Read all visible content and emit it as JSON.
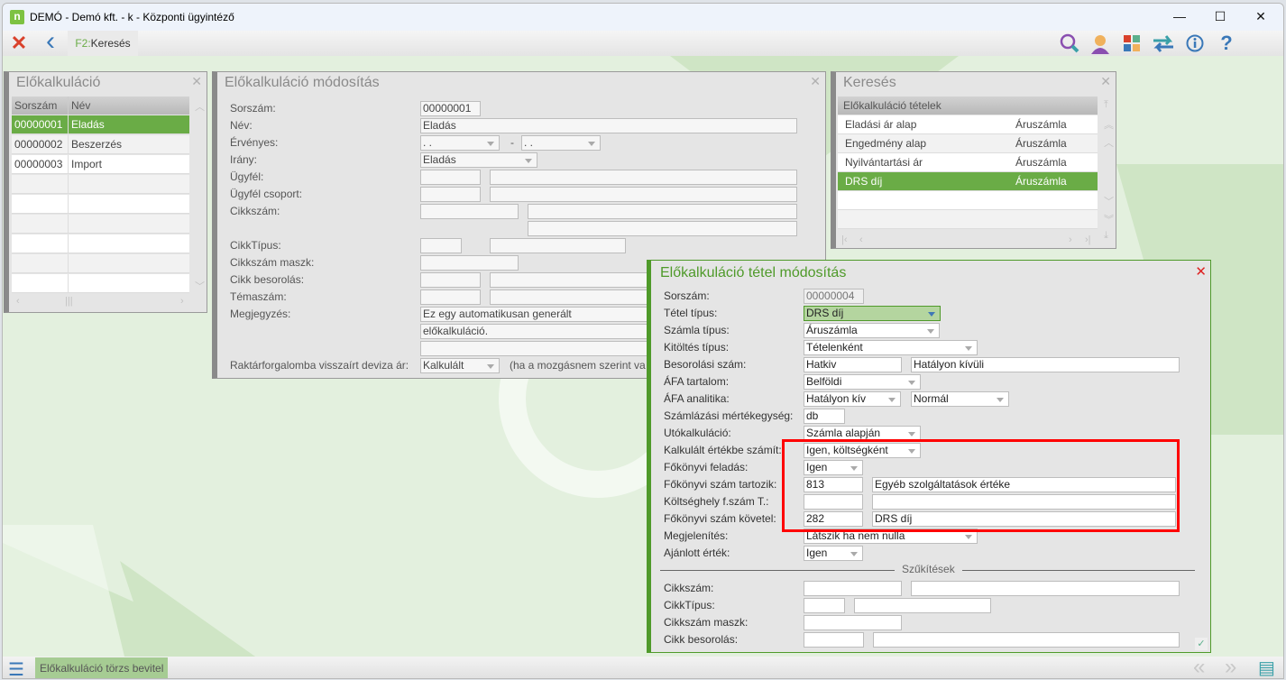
{
  "window": {
    "app_logo": "n",
    "title": "DEMÓ - Demó kft. - k - Központi ügyintéző",
    "minimize": "—",
    "maximize": "☐",
    "close": "✕"
  },
  "toolbar": {
    "close_icon": "✕",
    "back_icon": "‹",
    "search_key": "F2:",
    "search_label": "Keresés",
    "right_icons": [
      "search-icon",
      "user-icon",
      "tiles-icon",
      "transfer-icon",
      "info-icon",
      "help-icon"
    ]
  },
  "list_panel": {
    "title": "Előkalkuláció",
    "close": "✕",
    "columns": [
      "Sorszám",
      "Név"
    ],
    "rows": [
      [
        "00000001",
        "Eladás"
      ],
      [
        "00000002",
        "Beszerzés"
      ],
      [
        "00000003",
        "Import"
      ],
      [
        "",
        ""
      ],
      [
        "",
        ""
      ],
      [
        "",
        ""
      ],
      [
        "",
        ""
      ],
      [
        "",
        ""
      ],
      [
        "",
        ""
      ]
    ],
    "selected": 0
  },
  "edit_panel": {
    "title": "Előkalkuláció módosítás",
    "close": "✕",
    "rows": [
      {
        "label": "Sorszám:",
        "values": [
          "00000001"
        ]
      },
      {
        "label": "Név:",
        "values": [
          "Eladás"
        ]
      },
      {
        "label": "Érvényes:",
        "values": [
          ". .",
          ". ."
        ]
      },
      {
        "label": "Irány:",
        "values": [
          "Eladás"
        ]
      },
      {
        "label": "Ügyfél:",
        "values": [
          "",
          ""
        ]
      },
      {
        "label": "Ügyfél csoport:",
        "values": [
          "",
          ""
        ]
      },
      {
        "label": "Cikkszám:",
        "values": [
          "",
          ""
        ]
      },
      {
        "label": "",
        "values": [
          ""
        ]
      },
      {
        "label": "CikkTípus:",
        "values": [
          "",
          ""
        ]
      },
      {
        "label": "Cikkszám maszk:",
        "values": [
          ""
        ]
      },
      {
        "label": "Cikk besorolás:",
        "values": [
          "",
          ""
        ]
      },
      {
        "label": "Témaszám:",
        "values": [
          "",
          ""
        ]
      },
      {
        "label": "Megjegyzés:",
        "values": [
          "Ez egy automatikusan generált"
        ]
      },
      {
        "label": "",
        "values": [
          "előkalkuláció."
        ]
      },
      {
        "label": "",
        "values": [
          ""
        ]
      },
      {
        "label": "Raktárforgalomba visszaírt deviza ár:",
        "values": [
          "Kalkulált"
        ]
      }
    ],
    "date_separator": "-",
    "note": "(ha a mozgásnem szerint va"
  },
  "search_panel": {
    "title": "Keresés",
    "close": "✕",
    "header": "Előkalkuláció tételek",
    "rows": [
      [
        "Eladási ár alap",
        "Áruszámla"
      ],
      [
        "Engedmény alap",
        "Áruszámla"
      ],
      [
        "Nyilvántartási ár",
        "Áruszámla"
      ],
      [
        "DRS díj",
        "Áruszámla"
      ],
      [
        "",
        ""
      ],
      [
        "",
        ""
      ]
    ],
    "selected": 3
  },
  "dialog": {
    "title": "Előkalkuláció tétel módosítás",
    "close": "✕",
    "rows": [
      {
        "label": "Sorszám:",
        "values": [
          "00000004"
        ]
      },
      {
        "label": "Tétel típus:",
        "values": [
          "DRS díj"
        ]
      },
      {
        "label": "Számla típus:",
        "values": [
          "Áruszámla"
        ]
      },
      {
        "label": "Kitöltés típus:",
        "values": [
          "Tételenként"
        ]
      },
      {
        "label": "Besorolási szám:",
        "values": [
          "Hatkiv",
          "Hatályon kívüli"
        ]
      },
      {
        "label": "ÁFA tartalom:",
        "values": [
          "Belföldi"
        ]
      },
      {
        "label": "ÁFA analitika:",
        "values": [
          "Hatályon kív",
          "Normál"
        ]
      },
      {
        "label": "Számlázási mértékegység:",
        "values": [
          "db"
        ]
      },
      {
        "label": "Utókalkuláció:",
        "values": [
          "Számla alapján"
        ]
      },
      {
        "label": "Kalkulált értékbe számít:",
        "values": [
          "Igen, költségként"
        ]
      },
      {
        "label": "Főkönyvi feladás:",
        "values": [
          "Igen"
        ]
      },
      {
        "label": "Főkönyvi szám tartozik:",
        "values": [
          "813",
          "Egyéb szolgáltatások értéke"
        ]
      },
      {
        "label": "Költséghely f.szám T.:",
        "values": [
          "",
          ""
        ]
      },
      {
        "label": "Főkönyvi szám követel:",
        "values": [
          "282",
          "DRS díj"
        ]
      },
      {
        "label": "Megjelenítés:",
        "values": [
          "Látszik ha nem nulla"
        ]
      },
      {
        "label": "Ajánlott érték:",
        "values": [
          "Igen"
        ]
      }
    ],
    "section": "Szűkítések",
    "filter_rows": [
      {
        "label": "Cikkszám:",
        "values": [
          "",
          ""
        ]
      },
      {
        "label": "CikkTípus:",
        "values": [
          "",
          ""
        ]
      },
      {
        "label": "Cikkszám maszk:",
        "values": [
          ""
        ]
      },
      {
        "label": "Cikk besorolás:",
        "values": [
          "",
          ""
        ]
      }
    ],
    "ok_icon": "✓"
  },
  "statusbar": {
    "menu_icon": "☰",
    "task": "Előkalkuláció törzs bevitel",
    "prev": "«",
    "next": "»",
    "list_icon": "▤"
  },
  "colors": {
    "accent": "#6aac46",
    "dialog_border": "#4f9a2a",
    "highlight": "#ff0000",
    "background": "#e3f0de"
  }
}
